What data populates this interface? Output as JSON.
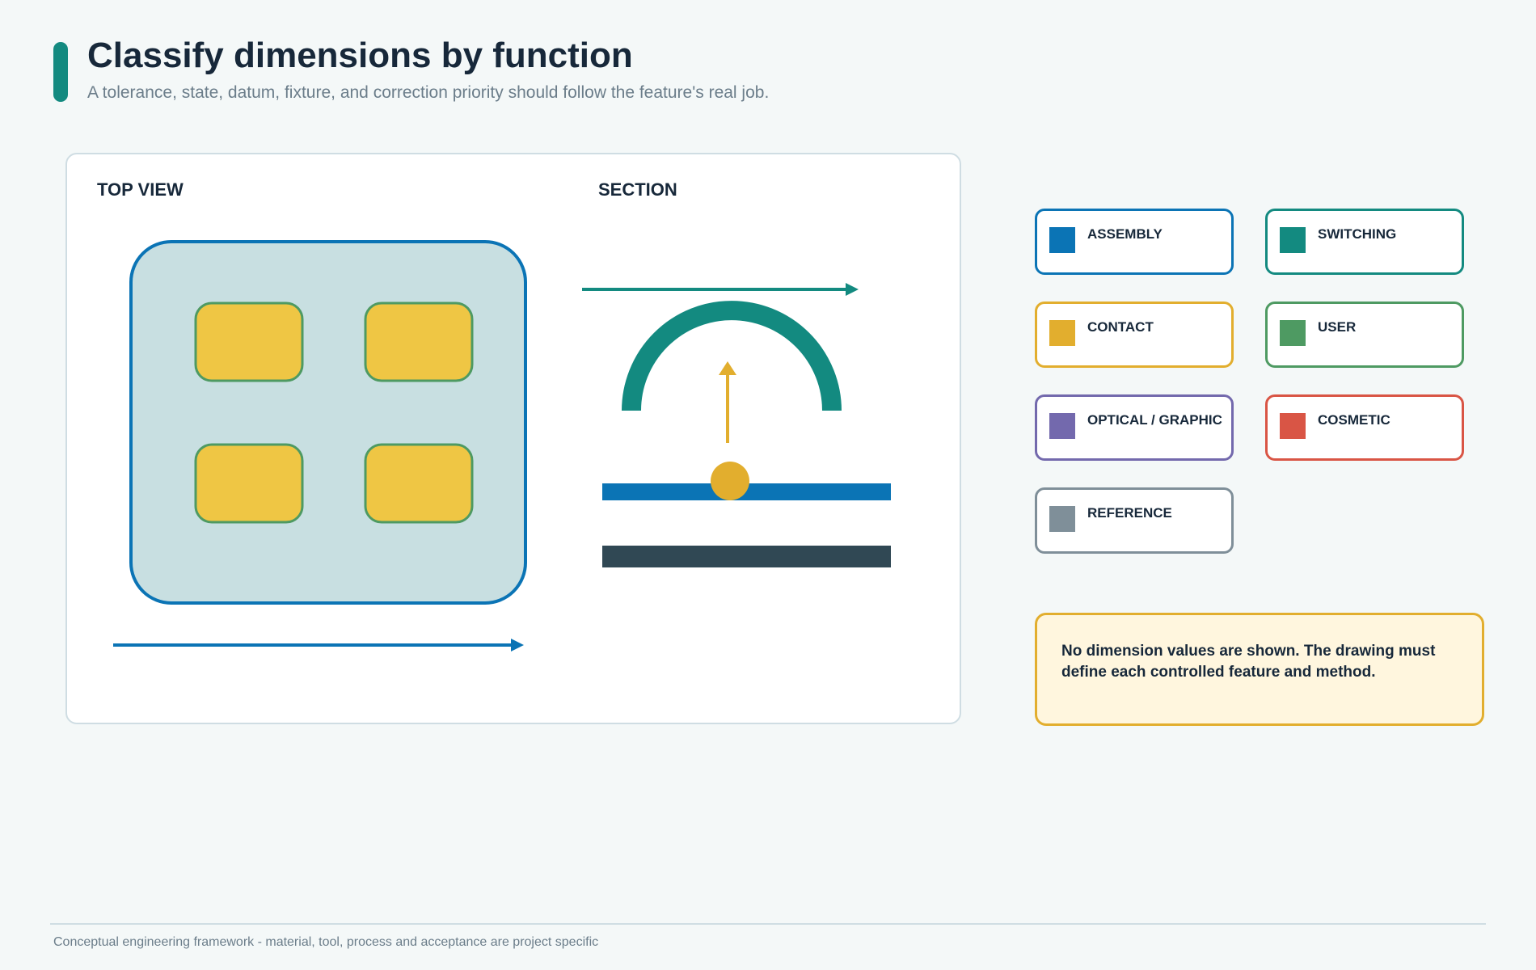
{
  "header": {
    "title": "Classify dimensions by function",
    "subtitle": "A tolerance, state, datum, fixture, and correction priority should follow the feature's real job."
  },
  "views": {
    "top_view_label": "TOP VIEW",
    "section_label": "SECTION"
  },
  "legend": [
    {
      "label": "ASSEMBLY",
      "color": "#0b74b5"
    },
    {
      "label": "SWITCHING",
      "color": "#138a80"
    },
    {
      "label": "CONTACT",
      "color": "#e2ae2e"
    },
    {
      "label": "USER",
      "color": "#4e9a62"
    },
    {
      "label": "OPTICAL / GRAPHIC",
      "color": "#7369ad"
    },
    {
      "label": "COSMETIC",
      "color": "#d95545"
    },
    {
      "label": "REFERENCE",
      "color": "#7f8f99"
    }
  ],
  "note": {
    "text": "No dimension values are shown. The drawing must define each controlled feature and method."
  },
  "footer": {
    "text": "Conceptual engineering framework - material, tool, process and acceptance are project specific"
  },
  "colors": {
    "accent": "#138a80",
    "assembly_blue": "#0b74b5",
    "contact_yellow": "#e2ae2e",
    "key_fill": "#efc644",
    "user_green": "#4e9a62",
    "body_fill": "#c8dfe1",
    "base_dark": "#304854"
  }
}
